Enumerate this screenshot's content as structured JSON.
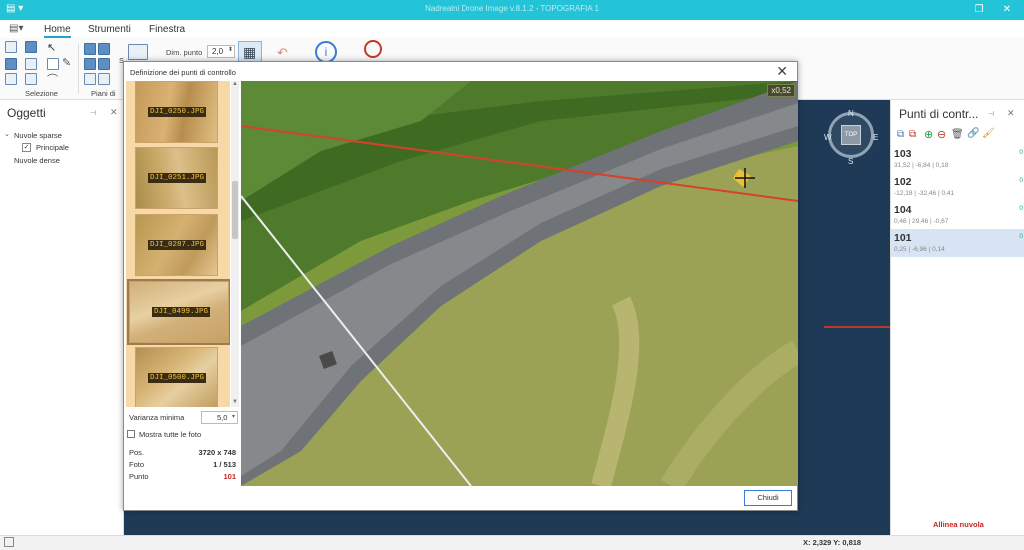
{
  "app": {
    "title": "Nadrealni Drone Image v.8.1.2 - TOPOGRAFIA 1"
  },
  "tabs": [
    {
      "label": "Home",
      "active": true
    },
    {
      "label": "Strumenti",
      "active": false
    },
    {
      "label": "Finestra",
      "active": false
    }
  ],
  "ribbon": {
    "group_selection": "Selezione",
    "group_planes": "Piani di",
    "dim_label": "Dim. punto",
    "dim_value": "2,0",
    "s_label": "S"
  },
  "left_panel": {
    "title": "Oggetti",
    "tree": {
      "group1": "Nuvole sparse",
      "child1": "Principale",
      "group2": "Nuvole dense"
    }
  },
  "dialog": {
    "title": "Definizione dei punti di controllo",
    "thumbnails": [
      "DJI_0250.JPG",
      "DJI_0251.JPG",
      "DJI_0287.JPG",
      "DJI_0499.JPG",
      "DJI_0500.JPG"
    ],
    "varianza_label": "Varianza minima",
    "varianza_value": "5,0",
    "mostra_label": "Mostra tutte le foto",
    "pos_label": "Pos.",
    "pos_value": "3720 x 748",
    "foto_label": "Foto",
    "foto_value": "1 / 513",
    "punto_label": "Punto",
    "punto_value": "101",
    "zoom": "x0,52",
    "close_button": "Chiudi"
  },
  "right_panel": {
    "title": "Punti di contr...",
    "points": [
      {
        "id": "103",
        "values": "31,52 | -6,84 | 0,18",
        "status": "0"
      },
      {
        "id": "102",
        "values": "-12,18 | -32,46 | 0,41",
        "status": "0"
      },
      {
        "id": "104",
        "values": "0,46 | 29,46 | -0,67",
        "status": "0"
      },
      {
        "id": "101",
        "values": "0,25 | -6,96 | 0,14",
        "status": "0"
      }
    ],
    "align_link": "Allinea nuvola"
  },
  "compass": {
    "n": "N",
    "s": "S",
    "e": "E",
    "w": "W",
    "top": "TOP"
  },
  "status": {
    "coords": "X: 2,329  Y: 0,818"
  },
  "colors": {
    "accent": "#23c4d8",
    "viewport_bg": "#1e3a56",
    "thumb_bg": "#f7d9a8",
    "selected_row": "#d6e4f3",
    "link_red": "#cc2222"
  }
}
